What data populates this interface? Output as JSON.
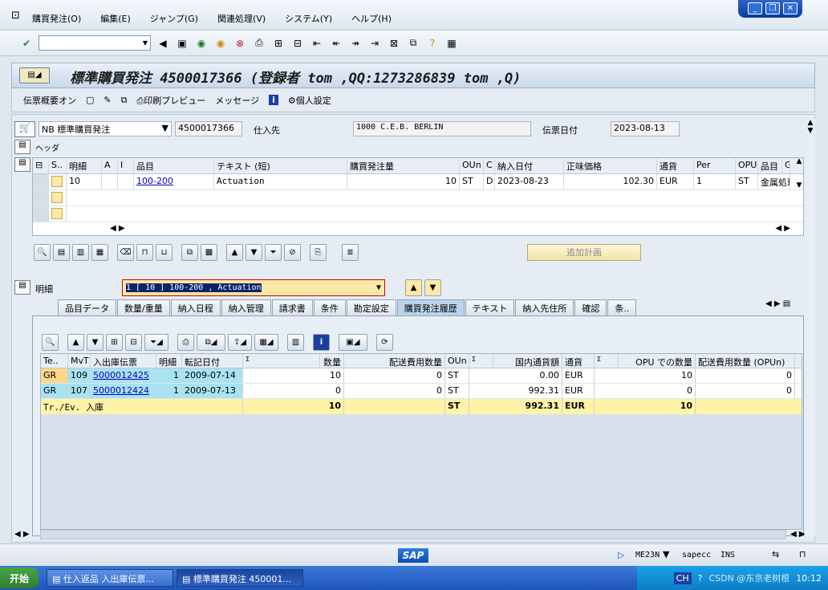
{
  "menu": {
    "items": [
      "購買発注(O)",
      "編集(E)",
      "ジャンプ(G)",
      "関連処理(V)",
      "システム(Y)",
      "ヘルプ(H)"
    ]
  },
  "title": "標準購買発注 4500017366 (登録者 tom ,QQ:1273286839 tom ,Q)",
  "apptoolbar": {
    "overview": "伝票概要オン",
    "print_preview": "印刷プレビュー",
    "messages": "メッセージ",
    "personal": "個人設定"
  },
  "header": {
    "doc_type": "NB 標準購買発注",
    "po_number": "4500017366",
    "vendor_label": "仕入先",
    "vendor": "1000 C.E.B. BERLIN",
    "doc_date_label": "伝票日付",
    "doc_date": "2023-08-13",
    "header_label": "ヘッダ"
  },
  "items_grid": {
    "columns": [
      "S..",
      "明細",
      "A",
      "I",
      "品目",
      "テキスト (短)",
      "購買発注量",
      "OUn",
      "C",
      "納入日付",
      "正味価格",
      "通貨",
      "Per",
      "OPU",
      "品目",
      "Gr"
    ],
    "rows": [
      {
        "item": "10",
        "material": "100-200",
        "text": "Actuation",
        "qty": "10",
        "oun": "ST",
        "c": "D",
        "date": "2023-08-23",
        "price": "102.30",
        "cur": "EUR",
        "per": "1",
        "opu": "ST",
        "mgrp": "金属処理"
      }
    ]
  },
  "add_plan": "追加計画",
  "detail": {
    "label": "明細",
    "selected": "1 [ 10 ] 100-200 , Actuation"
  },
  "tabs": [
    "品目データ",
    "数量/重量",
    "納入日程",
    "納入管理",
    "請求書",
    "条件",
    "勘定設定",
    "購買発注履歴",
    "テキスト",
    "納入先住所",
    "確認",
    "条.."
  ],
  "history": {
    "columns": [
      "Te..",
      "MvT",
      "入出庫伝票",
      "明細",
      "転記日付",
      "Σ",
      "数量",
      "配送費用数量",
      "OUn",
      "Σ",
      "国内通貨額",
      "通貨",
      "Σ",
      "OPU での数量",
      "配送費用数量 (OPUn)"
    ],
    "rows": [
      {
        "te": "GR",
        "mvt": "109",
        "doc": "5000012425",
        "item": "1",
        "date": "2009-07-14",
        "qty": "10",
        "dqty": "0",
        "oun": "ST",
        "amt": "0.00",
        "cur": "EUR",
        "opuq": "10",
        "dopu": "0"
      },
      {
        "te": "GR",
        "mvt": "107",
        "doc": "5000012424",
        "item": "1",
        "date": "2009-07-13",
        "qty": "0",
        "dqty": "0",
        "oun": "ST",
        "amt": "992.31",
        "cur": "EUR",
        "opuq": "0",
        "dopu": "0"
      }
    ],
    "total": {
      "label": "Tr./Ev. 入庫",
      "qty": "10",
      "oun": "ST",
      "amt": "992.31",
      "cur": "EUR",
      "opuq": "10"
    }
  },
  "status": {
    "logo": "SAP",
    "tcode": "ME23N",
    "server": "sapecc",
    "mode": "INS"
  },
  "taskbar": {
    "start": "开始",
    "task1": "仕入返品 入出庫伝票...",
    "task2": "標準購買発注 450001...",
    "lang": "CH",
    "watermark": "CSDN @东京老树根",
    "clock": "10:12"
  }
}
